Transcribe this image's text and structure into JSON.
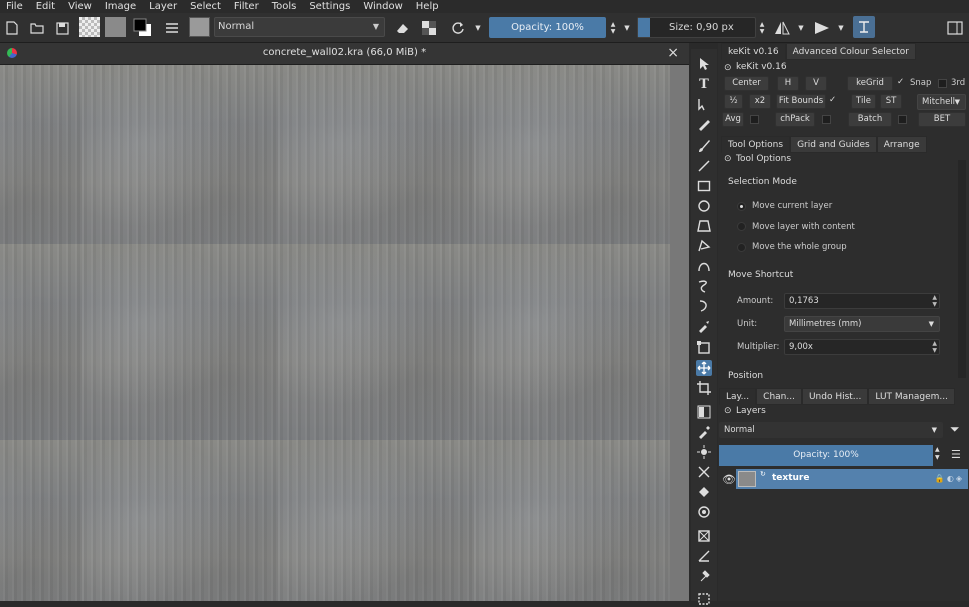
{
  "menu": [
    "File",
    "Edit",
    "View",
    "Image",
    "Layer",
    "Select",
    "Filter",
    "Tools",
    "Settings",
    "Window",
    "Help"
  ],
  "toolbar": {
    "blend_mode": "Normal",
    "opacity": "Opacity: 100%",
    "size": "Size: 0,90 px"
  },
  "document": {
    "title": "concrete_wall02.kra (66,0 MiB) *",
    "close": "×"
  },
  "dock_tabs": [
    "keKit v0.16",
    "Advanced Colour Selector"
  ],
  "kekit": {
    "title": "keKit v0.16",
    "row1": [
      "Center",
      "H",
      "V",
      "keGrid",
      "Snap",
      "3rd"
    ],
    "row2": [
      "½",
      "x2",
      "Fit Bounds",
      "Tile",
      "ST",
      "Mitchell"
    ],
    "row3": [
      "Avg",
      "chPack",
      "Batch",
      "BET"
    ]
  },
  "tool_tabs": [
    "Tool Options",
    "Grid and Guides",
    "Arrange"
  ],
  "tool_options": {
    "title": "Tool Options",
    "selection_mode": "Selection Mode",
    "modes": [
      "Move current layer",
      "Move layer with content",
      "Move the whole group"
    ],
    "move_shortcut": "Move Shortcut",
    "amount_label": "Amount:",
    "amount_value": "0,1763",
    "unit_label": "Unit:",
    "unit_value": "Millimetres (mm)",
    "multiplier_label": "Multiplier:",
    "multiplier_value": "9,00x",
    "position": "Position"
  },
  "layer_tabs": [
    "Lay...",
    "Chan...",
    "Undo Hist...",
    "LUT Managem..."
  ],
  "layers": {
    "title": "Layers",
    "blend_mode": "Normal",
    "opacity": "Opacity:  100%",
    "items": [
      {
        "name": "texture"
      }
    ]
  },
  "colors": {
    "accent": "#4a7aa7",
    "panel": "#2d2d2d"
  }
}
